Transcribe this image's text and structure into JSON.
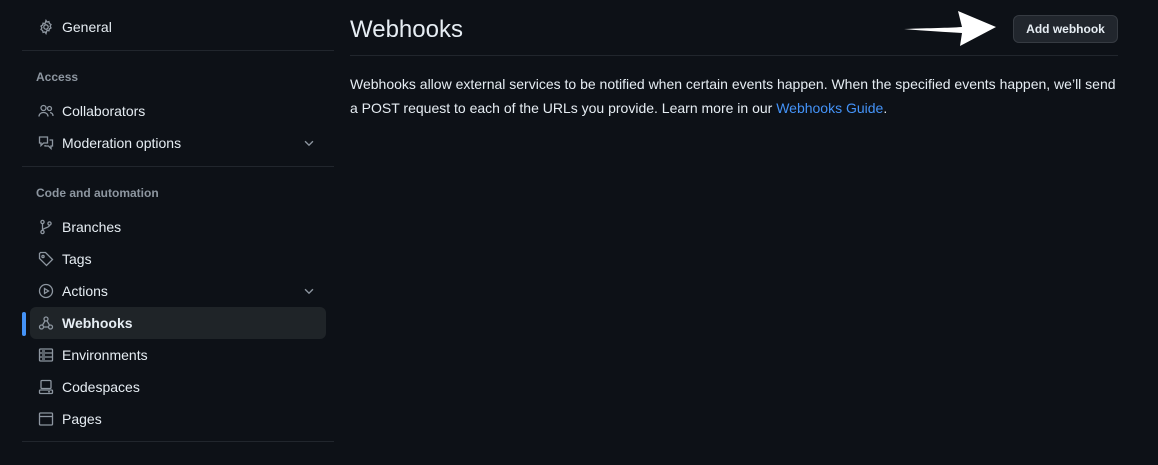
{
  "sidebar": {
    "general": {
      "label": "General",
      "icon": "gear-icon"
    },
    "access_heading": "Access",
    "collaborators": {
      "label": "Collaborators",
      "icon": "people-icon"
    },
    "moderation": {
      "label": "Moderation options",
      "icon": "comment-discussion-icon"
    },
    "code_heading": "Code and automation",
    "branches": {
      "label": "Branches",
      "icon": "git-branch-icon"
    },
    "tags": {
      "label": "Tags",
      "icon": "tag-icon"
    },
    "actions": {
      "label": "Actions",
      "icon": "play-icon"
    },
    "webhooks": {
      "label": "Webhooks",
      "icon": "webhook-icon",
      "active": true
    },
    "environments": {
      "label": "Environments",
      "icon": "server-icon"
    },
    "codespaces": {
      "label": "Codespaces",
      "icon": "codespaces-icon"
    },
    "pages": {
      "label": "Pages",
      "icon": "browser-icon"
    }
  },
  "main": {
    "title": "Webhooks",
    "add_button_label": "Add webhook",
    "description_text": "Webhooks allow external services to be notified when certain events happen. When the specified events happen, we’ll send a POST request to each of the URLs you provide. Learn more in our ",
    "guide_link_label": "Webhooks Guide",
    "description_end": "."
  },
  "colors": {
    "background": "#0d1117",
    "text": "#e6edf3",
    "muted": "#8d96a0",
    "accent": "#4493f8",
    "active_bg": "#1f2428"
  }
}
